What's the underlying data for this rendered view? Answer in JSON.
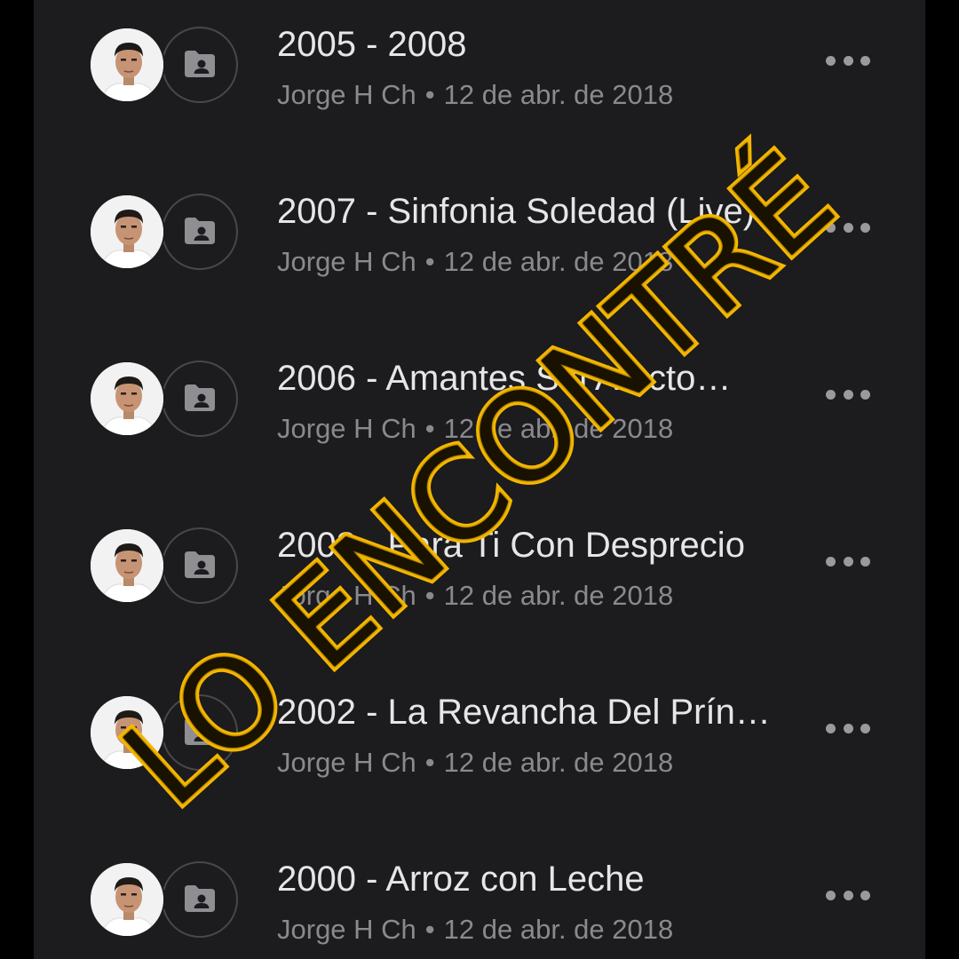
{
  "items": [
    {
      "title": "2005 - 2008",
      "author": "Jorge H Ch",
      "separator": "•",
      "date": "12 de abr. de 2018"
    },
    {
      "title": "2007 - Sinfonia Soledad (Live)",
      "author": "Jorge H Ch",
      "separator": "•",
      "date": "12 de abr. de 2018"
    },
    {
      "title": "2006 - Amantes Sin Afecto…",
      "author": "Jorge H Ch",
      "separator": "•",
      "date": "12 de abr. de 2018"
    },
    {
      "title": "2003 - Para Ti Con Desprecio",
      "author": "Jorge H Ch",
      "separator": "•",
      "date": "12 de abr. de 2018"
    },
    {
      "title": "2002 - La Revancha Del Prín…",
      "author": "Jorge H Ch",
      "separator": "•",
      "date": "12 de abr. de 2018"
    },
    {
      "title": "2000 - Arroz con Leche",
      "author": "Jorge H Ch",
      "separator": "•",
      "date": "12 de abr. de 2018"
    }
  ],
  "icons": {
    "avatar": "user-avatar-photo",
    "folder": "shared-folder-icon",
    "more": "more-options-icon"
  },
  "overlay_text": "LO ENCONTRÉ",
  "colors": {
    "background": "#1c1c1e",
    "overlay_stroke": "#f5b700",
    "overlay_fill": "#1a1200",
    "title": "#e6e6e8",
    "meta": "#8a8a8e"
  }
}
